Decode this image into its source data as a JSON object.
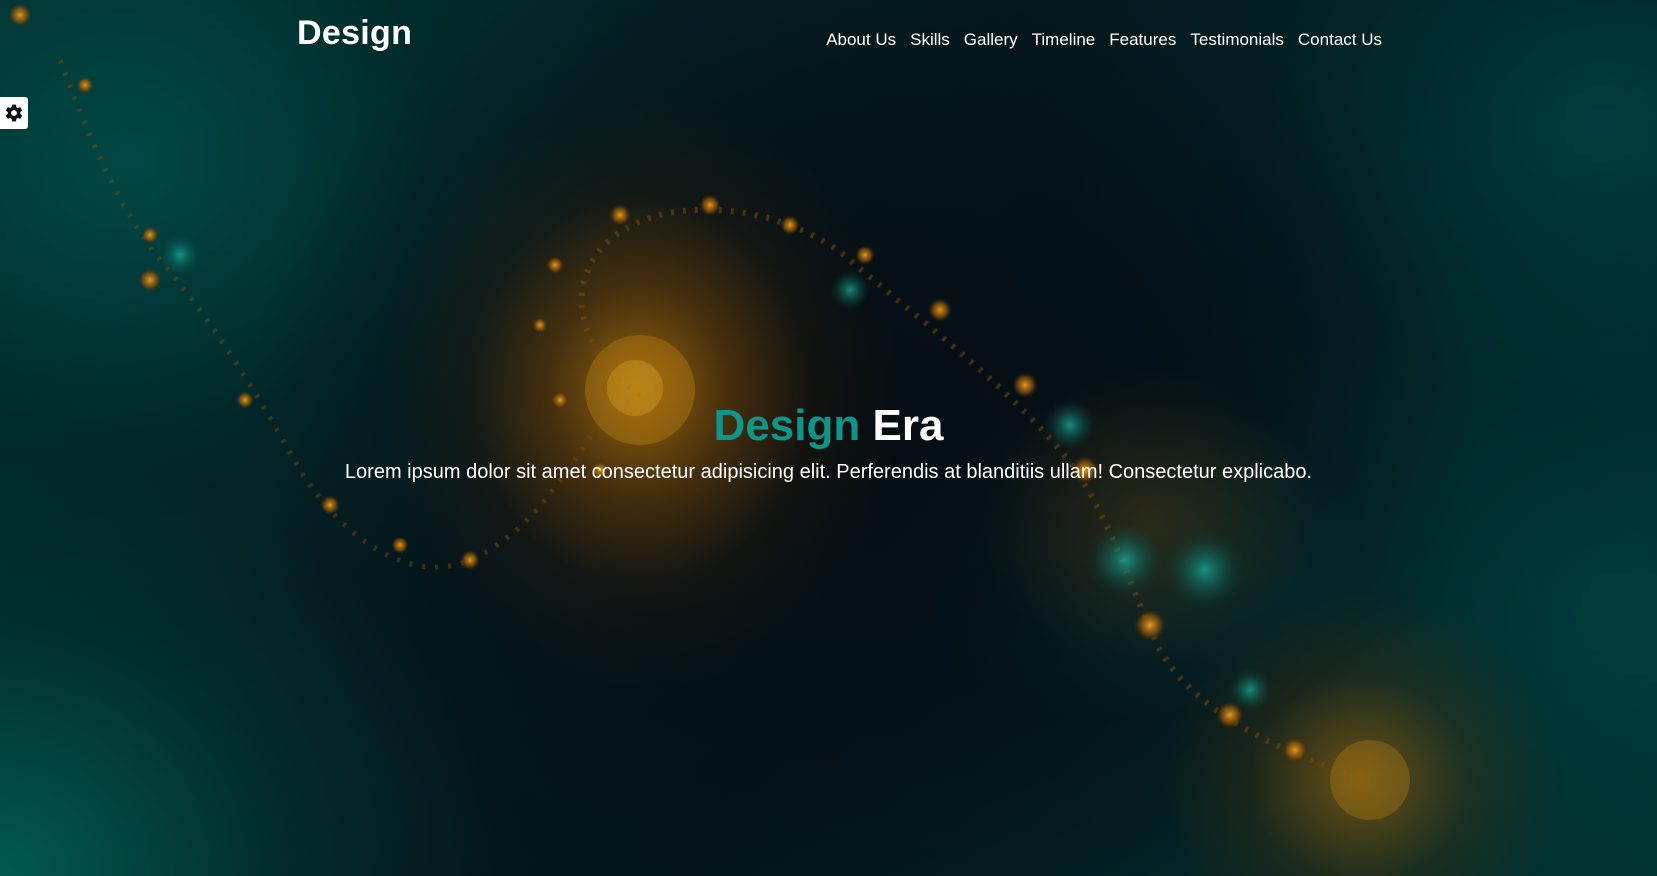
{
  "header": {
    "logo": "Design",
    "nav": [
      {
        "label": "About Us"
      },
      {
        "label": "Skills"
      },
      {
        "label": "Gallery"
      },
      {
        "label": "Timeline"
      },
      {
        "label": "Features"
      },
      {
        "label": "Testimonials"
      },
      {
        "label": "Contact Us"
      }
    ]
  },
  "settings": {
    "icon": "gear-icon"
  },
  "hero": {
    "title_accent": "Design",
    "title_rest": "Era",
    "text": "Lorem ipsum dolor sit amet consectetur adipisicing elit. Perferendis at blanditiis ullam! Consectetur explicabo."
  },
  "colors": {
    "accent": "#0f968a",
    "text": "#ffffff",
    "background": "#041a1f",
    "fractal_gold": "#b07010",
    "fractal_teal": "#00706a"
  }
}
